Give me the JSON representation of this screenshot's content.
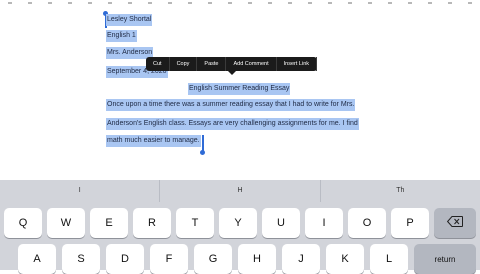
{
  "document": {
    "lines": [
      "Lesley Shortal",
      "English 1",
      "Mrs. Anderson",
      "September 4, 2020",
      "English Summer Reading Essay",
      "Once upon a time there was a summer reading essay that I had to write for Mrs.",
      "Anderson's English class. Essays are very challenging assignments for me. I find",
      "math much easier to manage."
    ]
  },
  "edit_menu": {
    "items": [
      "Cut",
      "Copy",
      "Paste",
      "Add Comment",
      "Insert Link"
    ]
  },
  "keyboard": {
    "predictions": [
      "I",
      "H",
      "Th"
    ],
    "row1": [
      "Q",
      "W",
      "E",
      "R",
      "T",
      "Y",
      "U",
      "I",
      "O",
      "P"
    ],
    "row2": [
      "A",
      "S",
      "D",
      "F",
      "G",
      "H",
      "J",
      "K",
      "L"
    ],
    "delete_icon": "backspace-icon",
    "return_label": "return"
  },
  "colors": {
    "selection": "#a9c6f2",
    "handle": "#2f6bd6",
    "menu": "#1b1b1b",
    "keyboard_bg": "#d2d4da"
  }
}
